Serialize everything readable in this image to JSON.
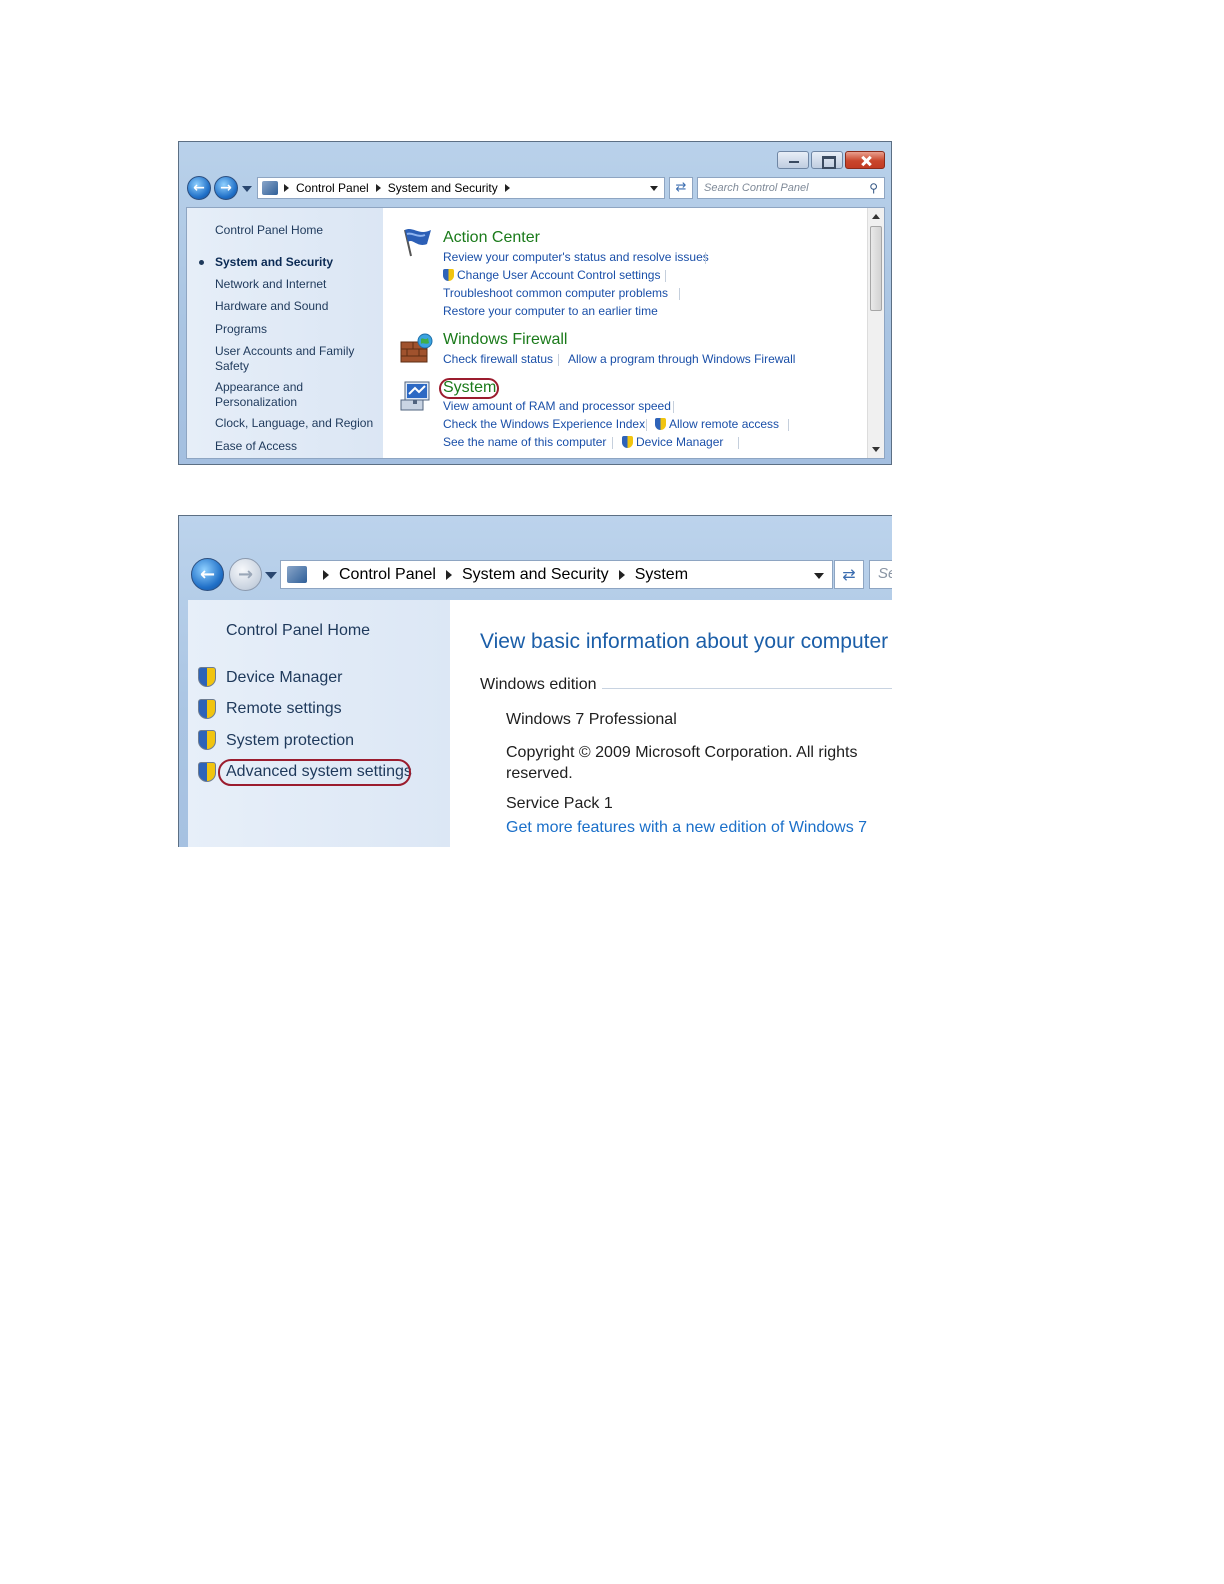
{
  "window1": {
    "breadcrumb": [
      "Control Panel",
      "System and Security"
    ],
    "search_placeholder": "Search Control Panel",
    "sidebar": {
      "home": "Control Panel Home",
      "items": [
        "System and Security",
        "Network and Internet",
        "Hardware and Sound",
        "Programs",
        "User Accounts and Family Safety",
        "Appearance and Personalization",
        "Clock, Language, and Region",
        "Ease of Access"
      ],
      "active_index": 0
    },
    "sections": {
      "action_center": {
        "title": "Action Center",
        "links": [
          "Review your computer's status and resolve issues",
          "Change User Account Control settings",
          "Troubleshoot common computer problems",
          "Restore your computer to an earlier time"
        ]
      },
      "firewall": {
        "title": "Windows Firewall",
        "links": [
          "Check firewall status",
          "Allow a program through Windows Firewall"
        ]
      },
      "system": {
        "title": "System",
        "links": [
          "View amount of RAM and processor speed",
          "Check the Windows Experience Index",
          "Allow remote access",
          "See the name of this computer",
          "Device Manager"
        ]
      }
    }
  },
  "window2": {
    "breadcrumb": [
      "Control Panel",
      "System and Security",
      "System"
    ],
    "search_placeholder": "Se",
    "sidebar": {
      "home": "Control Panel Home",
      "items": [
        "Device Manager",
        "Remote settings",
        "System protection",
        "Advanced system settings"
      ]
    },
    "main": {
      "heading": "View basic information about your computer",
      "group_label": "Windows edition",
      "edition": "Windows 7 Professional",
      "copyright": "Copyright © 2009 Microsoft Corporation.  All rights reserved.",
      "service_pack": "Service Pack 1",
      "upgrade_link": "Get more features with a new edition of Windows 7"
    }
  },
  "colors": {
    "highlight_oval": "#9b1c2e",
    "section_title": "#1a7a1a",
    "link": "#1a4fa8"
  }
}
